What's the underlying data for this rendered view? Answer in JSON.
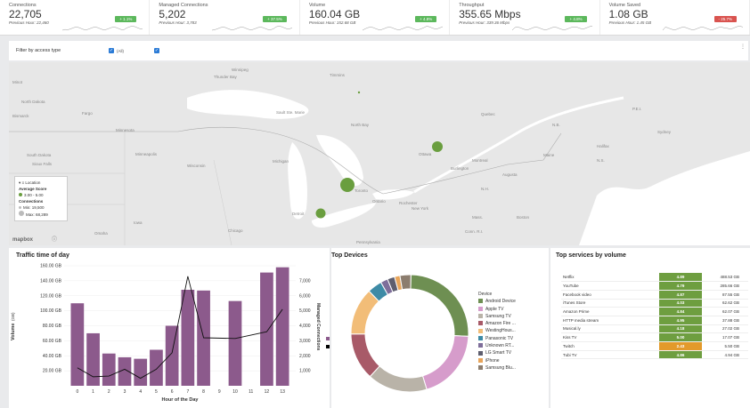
{
  "kpis": [
    {
      "title": "Connections",
      "value": "22,705",
      "previous": "Previous Hour: 22,460",
      "badge": "+ 1.1%",
      "badge_color": "#5cb85c"
    },
    {
      "title": "Managed Connections",
      "value": "5,202",
      "previous": "Previous Hour: 3,783",
      "badge": "+ 37.5%",
      "badge_color": "#5cb85c"
    },
    {
      "title": "Volume",
      "value": "160.04 GB",
      "previous": "Previous Hour: 152.68 GB",
      "badge": "+ 4.8%",
      "badge_color": "#5cb85c"
    },
    {
      "title": "Throughput",
      "value": "355.65 Mbps",
      "previous": "Previous Hour: 339.36 Mbps",
      "badge": "+ 4.8%",
      "badge_color": "#5cb85c"
    },
    {
      "title": "Volume Saved",
      "value": "1.08 GB",
      "previous": "Previous Hour: 1.45 GB",
      "badge": "- 25.7%",
      "badge_color": "#d9534f"
    }
  ],
  "filter": {
    "label": "Filter by access type",
    "option_all": "(All)"
  },
  "map": {
    "labels": [
      "Winnipeg",
      "Thunder Bay",
      "Timmins",
      "Minot",
      "North Dakota",
      "Bismarck",
      "Fargo",
      "Minnesota",
      "South Dakota",
      "Sioux Falls",
      "Minneapolis",
      "Wisconsin",
      "Michigan",
      "Iowa",
      "Omaha",
      "Chicago",
      "Detroit",
      "Toronto",
      "Ontario",
      "New York",
      "Ottawa",
      "Montreal",
      "Burlington",
      "Quebec",
      "N.B.",
      "Maine",
      "Augusta",
      "Halifax",
      "N.S.",
      "P.E.I.",
      "Sydney",
      "Sault Ste. Marie",
      "North Bay",
      "Rochester",
      "N.H.",
      "Mass.",
      "Conn. R.I.",
      "Pennsylvania",
      "Boston"
    ],
    "legend": {
      "heading": "Location",
      "score_title": "Average Score",
      "score_value": "3.00 - 5.00",
      "conn_title": "Connections",
      "conn_min": "Min: 19,500",
      "conn_max": "Max: 68,289"
    },
    "attribution": "mapbox"
  },
  "traffic": {
    "title": "Traffic time of day",
    "ylabel_left": "Volume",
    "ylabel_left_sub": "(GB)",
    "ylabel_right": "Managed Connections",
    "xlabel": "Hour of the Day"
  },
  "devices": {
    "title": "Top Devices",
    "legend_title": "Device",
    "items": [
      {
        "name": "Android Device",
        "color": "#6e8f52",
        "share": 0.255
      },
      {
        "name": "Apple TV",
        "color": "#d69ccb",
        "share": 0.195
      },
      {
        "name": "Samsung TV",
        "color": "#b9b3a8",
        "share": 0.165
      },
      {
        "name": "Amazon Fire ...",
        "color": "#a85a68",
        "share": 0.13
      },
      {
        "name": "WestingHous...",
        "color": "#f2bd78",
        "share": 0.13
      },
      {
        "name": "Panasonic TV",
        "color": "#3e8ba6",
        "share": 0.04
      },
      {
        "name": "Unknown RT...",
        "color": "#7e6e9a",
        "share": 0.02
      },
      {
        "name": "LG Smart TV",
        "color": "#5e5e6e",
        "share": 0.02
      },
      {
        "name": "iPhone",
        "color": "#e8a55b",
        "share": 0.015
      },
      {
        "name": "Samsung Blu...",
        "color": "#8c7d6e",
        "share": 0.03
      }
    ]
  },
  "services": {
    "title": "Top services by volume",
    "rows": [
      {
        "name": "Netflix",
        "score": "4.89",
        "volume": "488.53 GB",
        "color": "#6e9e40"
      },
      {
        "name": "YouTube",
        "score": "4.79",
        "volume": "285.66 GB",
        "color": "#6e9e40"
      },
      {
        "name": "Facebook video",
        "score": "4.87",
        "volume": "87.55 GB",
        "color": "#6e9e40"
      },
      {
        "name": "iTunes Store",
        "score": "4.03",
        "volume": "62.62 GB",
        "color": "#6e9e40"
      },
      {
        "name": "Amazon Prime",
        "score": "4.84",
        "volume": "62.07 GB",
        "color": "#6e9e40"
      },
      {
        "name": "HTTP media stream",
        "score": "4.95",
        "volume": "37.88 GB",
        "color": "#6e9e40"
      },
      {
        "name": "Musical.ly",
        "score": "4.18",
        "volume": "27.02 GB",
        "color": "#6e9e40"
      },
      {
        "name": "Kiss TV",
        "score": "5.00",
        "volume": "17.07 GB",
        "color": "#6e9e40"
      },
      {
        "name": "Twitch",
        "score": "2.43",
        "volume": "5.50 GB",
        "color": "#e39a2b"
      },
      {
        "name": "Tubi TV",
        "score": "4.86",
        "volume": "4.94 GB",
        "color": "#6e9e40"
      }
    ]
  },
  "chart_data": {
    "type": "bar",
    "title": "Traffic time of day",
    "xlabel": "Hour of the Day",
    "ylabel": "Volume (GB)",
    "ylabel_right": "Managed Connections",
    "categories": [
      "0",
      "1",
      "2",
      "3",
      "4",
      "5",
      "6",
      "7",
      "8",
      "9",
      "10",
      "11",
      "12",
      "13"
    ],
    "series": [
      {
        "values": [
          110,
          70,
          43,
          38,
          36,
          48,
          80,
          128,
          127,
          113,
          151,
          158
        ],
        "color": "#8c5a8c",
        "axis": "left"
      },
      {
        "values": [
          1200,
          600,
          650,
          1100,
          500,
          1100,
          2200,
          7300,
          3200,
          3150,
          3600,
          5100
        ],
        "color": "#111111",
        "axis": "right",
        "type": "line"
      }
    ],
    "bar_x": [
      "0",
      "1",
      "2",
      "3",
      "4",
      "5",
      "6",
      "7",
      "8",
      "10",
      "12",
      "13"
    ],
    "ylim": [
      0,
      160
    ],
    "ylim_right": [
      0,
      8000
    ],
    "yticks_left": [
      "20.00 GB",
      "40.00 GB",
      "60.00 GB",
      "80.00 GB",
      "100.00 GB",
      "120.00 GB",
      "140.00 GB",
      "160.00 GB"
    ],
    "yticks_right": [
      "1,000",
      "2,000",
      "3,000",
      "4,000",
      "5,000",
      "6,000",
      "7,000"
    ]
  }
}
